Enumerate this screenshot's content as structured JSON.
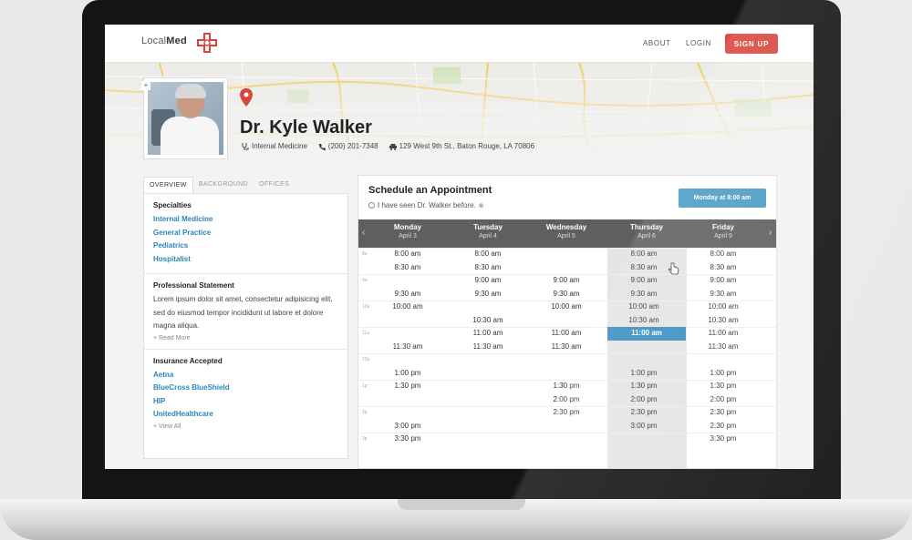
{
  "brand": {
    "name_light": "Local",
    "name_bold": "Med",
    "accent": "#d9453b"
  },
  "nav": {
    "about": "ABOUT",
    "login": "LOGIN",
    "signup": "SIGN UP"
  },
  "doctor": {
    "name": "Dr. Kyle Walker",
    "specialty": "Internal Medicine",
    "phone": "(200) 201-7348",
    "address": "129 West 9th St., Baton Rouge, LA 70806"
  },
  "tabs": [
    "OVERVIEW",
    "BACKGROUND",
    "OFFICES"
  ],
  "specialties": {
    "title": "Specialties",
    "items": [
      "Internal Medicine",
      "General Practice",
      "Pediatrics",
      "Hospitalist"
    ]
  },
  "statement": {
    "title": "Professional Statement",
    "text": "Lorem ipsum dolor sit amet, consectetur adipisicing elit, sed do eiusmod tempor incididunt ut labore et dolore magna aliqua.",
    "more": "+ Read More"
  },
  "insurance": {
    "title": "Insurance Accepted",
    "items": [
      "Aetna",
      "BlueCross BlueShield",
      "HIP",
      "UnitedHealthcare"
    ],
    "more": "+ View All"
  },
  "schedule": {
    "title": "Schedule an Appointment",
    "seen_label": "I have seen Dr. Walker before.",
    "selected_button": "Monday at 8:00 am",
    "days": [
      {
        "name": "Monday",
        "date": "April 3"
      },
      {
        "name": "Tuesday",
        "date": "April 4"
      },
      {
        "name": "Wednesday",
        "date": "April 5"
      },
      {
        "name": "Thursday",
        "date": "April 6"
      },
      {
        "name": "Friday",
        "date": "April 9"
      }
    ],
    "hours": [
      "8a",
      "9a",
      "10a",
      "11a",
      "12p",
      "1p",
      "2p",
      "3p"
    ],
    "slots": [
      [
        "8:00 am",
        "8:00 am",
        "",
        "8:00 am",
        "8:00 am"
      ],
      [
        "8:30 am",
        "8:30 am",
        "",
        "8:30 am",
        "8:30 am"
      ],
      [
        "",
        "9:00 am",
        "9:00 am",
        "9:00 am",
        "9:00 am"
      ],
      [
        "9:30 am",
        "9:30 am",
        "9:30 am",
        "9:30 am",
        "9:30 am"
      ],
      [
        "10:00 am",
        "",
        "10:00 am",
        "10:00 am",
        "10:00 am"
      ],
      [
        "",
        "10:30 am",
        "",
        "10:30 am",
        "10:30 am"
      ],
      [
        "",
        "11:00 am",
        "11:00 am",
        "11:00 am",
        "11:00 am"
      ],
      [
        "11:30 am",
        "11:30 am",
        "11:30 am",
        "",
        "11:30 am"
      ],
      [
        "",
        "",
        "",
        "",
        ""
      ],
      [
        "1:00 pm",
        "",
        "",
        "1:00 pm",
        "1:00 pm"
      ],
      [
        "1:30 pm",
        "",
        "1:30 pm",
        "1:30 pm",
        "1:30 pm"
      ],
      [
        "",
        "",
        "2:00 pm",
        "2:00 pm",
        "2:00 pm"
      ],
      [
        "",
        "",
        "2:30 pm",
        "2:30 pm",
        "2:30 pm"
      ],
      [
        "3:00 pm",
        "",
        "",
        "3:00 pm",
        "2:30 pm"
      ],
      [
        "3:30 pm",
        "",
        "",
        "",
        "3:30 pm"
      ]
    ],
    "selected": {
      "row": 6,
      "col": 3
    }
  },
  "colors": {
    "link": "#2a86b8",
    "button": "#4a9cc6",
    "day_header": "#5f5f5f",
    "selected_slot": "#3a8fc0"
  }
}
